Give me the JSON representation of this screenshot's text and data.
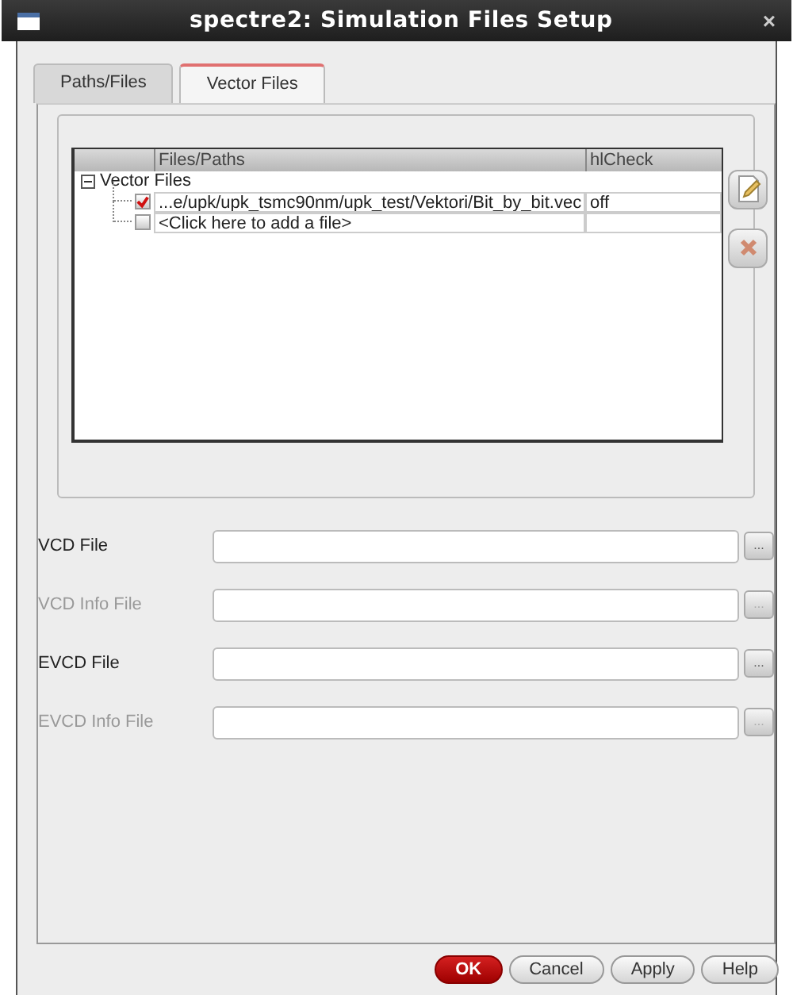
{
  "window": {
    "title": "spectre2: Simulation Files Setup",
    "close": "×"
  },
  "tabs": [
    {
      "label": "Paths/Files",
      "selected": false
    },
    {
      "label": "Vector Files",
      "selected": true
    }
  ],
  "table": {
    "columns": [
      "Files/Paths",
      "hlCheck"
    ],
    "tree": {
      "label": "Vector Files",
      "expanded": true,
      "children": [
        {
          "path": "...e/upk/upk_tsmc90nm/upk_test/Vektori/Bit_by_bit.vec",
          "hlcheck": "off",
          "checked": true
        },
        {
          "path": "<Click here to add a file>",
          "checked": false
        }
      ]
    }
  },
  "fields": [
    {
      "label": "VCD File",
      "disabled": false,
      "browse": "..."
    },
    {
      "label": "VCD Info File",
      "disabled": true,
      "browse": "..."
    },
    {
      "label": "EVCD File",
      "disabled": false,
      "browse": "..."
    },
    {
      "label": "EVCD Info File",
      "disabled": true,
      "browse": "..."
    }
  ],
  "buttons": [
    {
      "label": "OK",
      "kind": "primary"
    },
    {
      "label": "Cancel",
      "kind": "normal"
    },
    {
      "label": "Apply",
      "kind": "normal"
    },
    {
      "label": "Help",
      "kind": "normal"
    }
  ]
}
